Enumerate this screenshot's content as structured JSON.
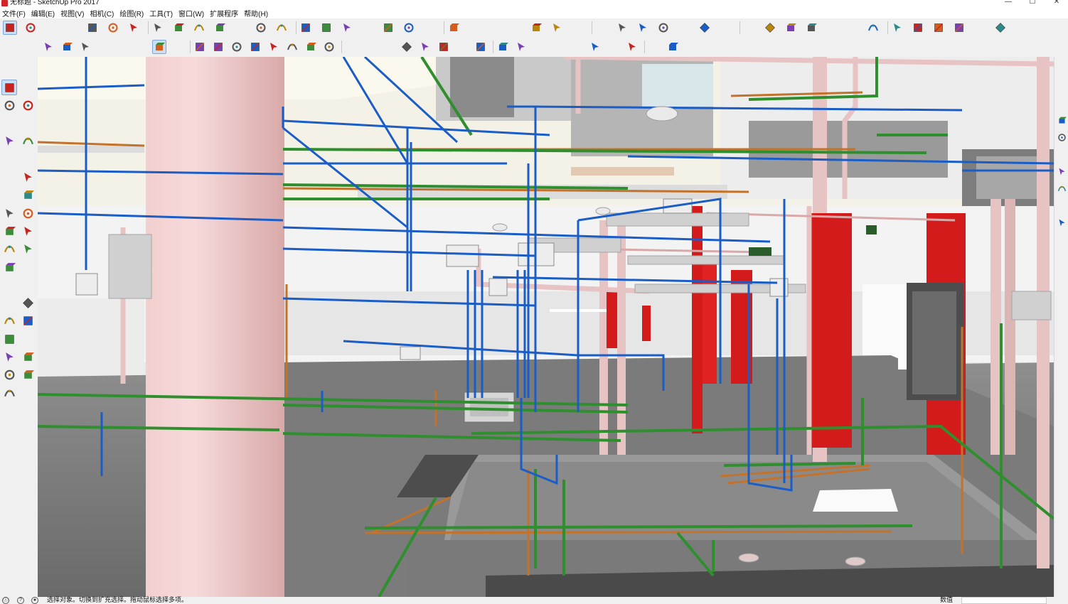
{
  "window": {
    "title": "无标题 - SketchUp Pro 2017",
    "minimize_glyph": "—",
    "maximize_glyph": "☐",
    "close_glyph": "✕"
  },
  "menu": [
    {
      "label": "文件(F)"
    },
    {
      "label": "编辑(E)"
    },
    {
      "label": "视图(V)"
    },
    {
      "label": "相机(C)"
    },
    {
      "label": "绘图(R)"
    },
    {
      "label": "工具(T)"
    },
    {
      "label": "窗口(W)"
    },
    {
      "label": "扩展程序"
    },
    {
      "label": "帮助(H)"
    }
  ],
  "toolbar_primary": [
    "select-tool",
    "eraser-tool",
    "line-tool",
    "arc-tool",
    "shape-tool",
    "push-pull-tool",
    "follow-me-tool",
    "move-tool",
    "rotate-tool",
    "scale-tool",
    "tape-measure-tool",
    "text-tool",
    "paint-bucket-tool",
    "orbit-tool",
    "pan-tool",
    "zoom-tool",
    "zoom-extents-tool",
    "warehouse-tool",
    "share-model-tool",
    "extension-warehouse-tool",
    "ruby-tool",
    "iso-view",
    "top-view",
    "front-view",
    "right-view",
    "back-view",
    "left-view",
    "section-plane-tool",
    "section-display-tool",
    "add-location-tool",
    "terrain-tool",
    "style-tool",
    "shadow-tool",
    "camera-tool",
    "photo-tool",
    "match-photo-tool",
    "layout-tool",
    "sandbox-tool",
    "smoove-tool",
    "drape-tool",
    "flip-edge-tool",
    "solid-union-tool",
    "solid-subtract-tool",
    "solid-trim-tool",
    "solid-split-tool",
    "hidden-line-tool",
    "xray-tool",
    "fog-tool"
  ],
  "toolbar_secondary": [
    "group-tool",
    "component-tool",
    "explode-tool",
    "outliner-tool",
    "layers-tool",
    "xray-face-tool",
    "back-edges-tool",
    "wireframe-tool",
    "hidden-line-tool",
    "shaded-tool",
    "textured-tool",
    "monochrome-tool",
    "perspective-tool",
    "walk-tool",
    "look-around-tool",
    "position-camera-tool",
    "dimension-tool",
    "protractor-tool",
    "axes-tool",
    "3d-text-tool",
    "sandbox-contours-tool",
    "sandbox-scratch-tool",
    "stamp-tool",
    "add-detail-tool",
    "flip-tool",
    "soften-edge-tool",
    "smooth-tool",
    "intersect-tool",
    "outer-shell-tool",
    "solid-inspector-tool",
    "fix-tool",
    "warning-tool",
    "export-tool",
    "import-tool"
  ],
  "left_palette": [
    "select-tool",
    "component-select-tool",
    "paint-bucket-tool",
    "eraser-tool",
    "line-tool",
    "freehand-tool",
    "rectangle-tool",
    "rotated-rectangle-tool",
    "circle-tool",
    "polygon-tool",
    "arc-tool",
    "pie-tool",
    "two-point-arc-tool",
    "three-point-arc-tool",
    "move-tool",
    "push-pull-tool",
    "rotate-tool",
    "follow-me-tool",
    "scale-tool",
    "offset-tool",
    "tape-measure-tool",
    "dimension-tool",
    "protractor-tool",
    "text-tool",
    "axes-tool",
    "3d-text-tool",
    "orbit-tool",
    "pan-tool",
    "zoom-tool",
    "zoom-window-tool",
    "zoom-extents-tool",
    "previous-view-tool",
    "position-camera-tool",
    "look-around-tool",
    "walk-tool",
    "section-plane-tool"
  ],
  "right_strip": [
    "entity-info-icon",
    "materials-icon",
    "components-icon",
    "styles-icon",
    "layers-icon",
    "outliner-icon",
    "scenes-icon",
    "shadows-icon",
    "fog-icon",
    "soften-icon",
    "instructor-icon"
  ],
  "statusbar": {
    "geo_icon": "ⓘ",
    "credit_icon": "?",
    "user_icon": "●",
    "text": "选择对象。切换到扩充选择。拖动鼠标选择多项。",
    "vcb_label": "数值",
    "vcb_value": ""
  },
  "colors": {
    "accent_blue": "#1a5dc6",
    "pipe_green": "#2f8f2f",
    "pipe_orange": "#c2722a",
    "pipe_pink": "#e8c3c3",
    "fire_red": "#d41b1b"
  }
}
